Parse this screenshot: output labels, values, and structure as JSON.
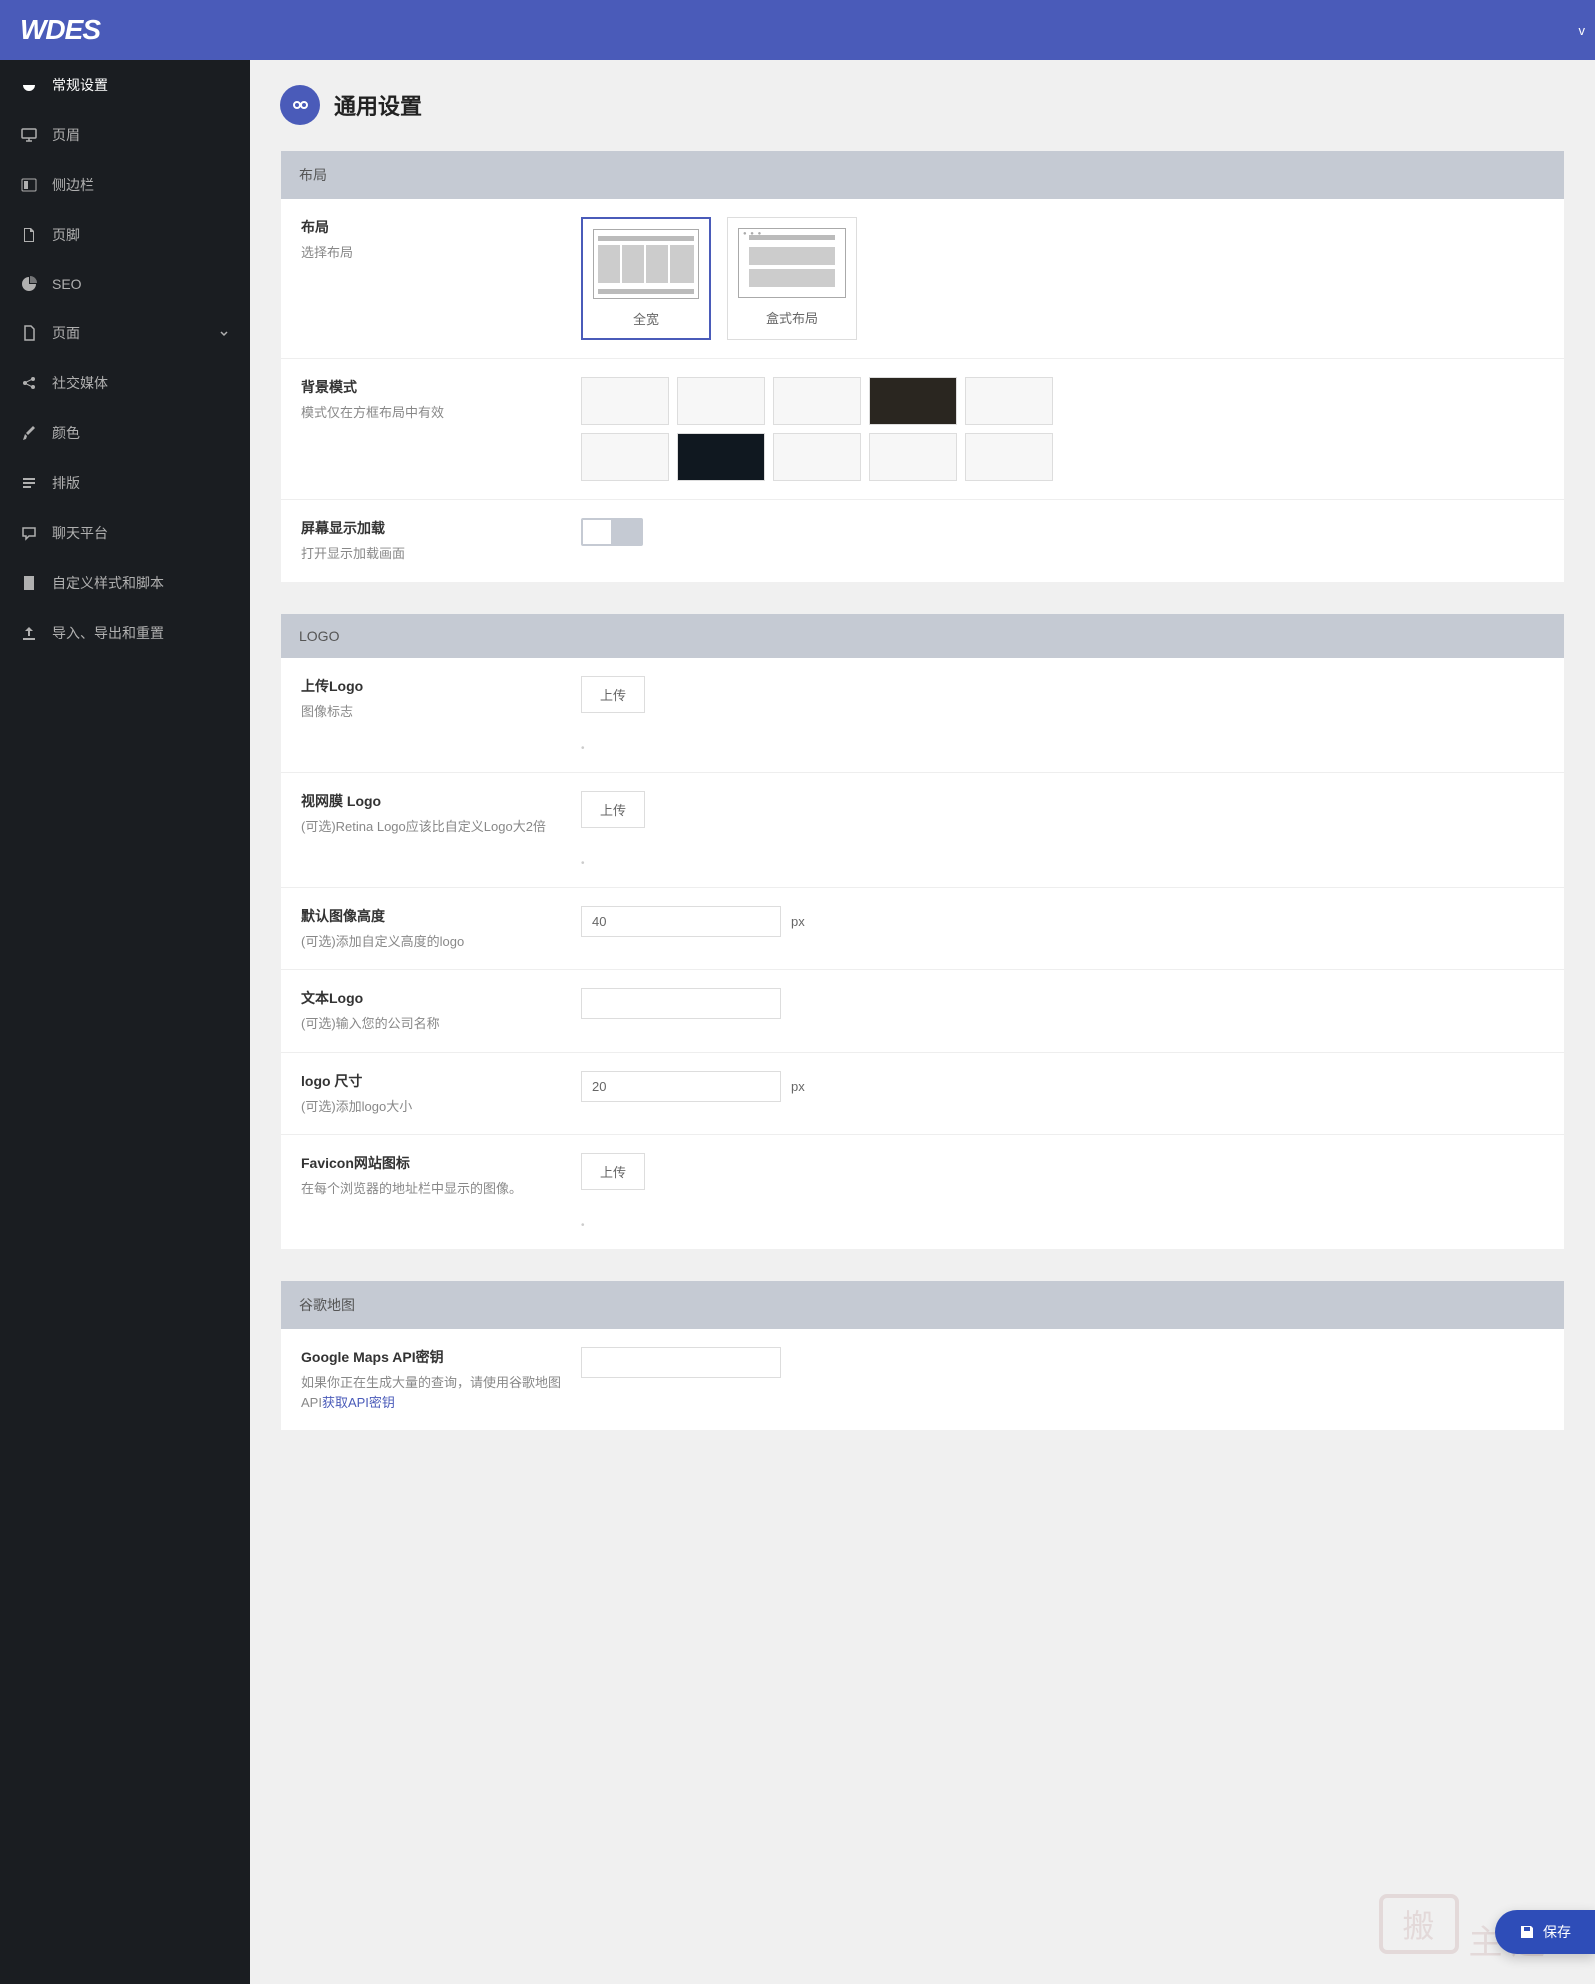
{
  "header": {
    "brand": "WDES",
    "right_char": "v"
  },
  "sidebar": {
    "items": [
      {
        "label": "常规设置",
        "icon": "dashboard-icon",
        "active": true
      },
      {
        "label": "页眉",
        "icon": "monitor-icon"
      },
      {
        "label": "侧边栏",
        "icon": "columns-icon"
      },
      {
        "label": "页脚",
        "icon": "file-icon"
      },
      {
        "label": "SEO",
        "icon": "chart-pie-icon"
      },
      {
        "label": "页面",
        "icon": "page-icon",
        "expandable": true
      },
      {
        "label": "社交媒体",
        "icon": "share-icon"
      },
      {
        "label": "颜色",
        "icon": "brush-icon"
      },
      {
        "label": "排版",
        "icon": "text-icon"
      },
      {
        "label": "聊天平台",
        "icon": "chat-icon"
      },
      {
        "label": "自定义样式和脚本",
        "icon": "file-alt-icon"
      },
      {
        "label": "导入、导出和重置",
        "icon": "upload-icon"
      }
    ]
  },
  "page": {
    "title": "通用设置"
  },
  "sections": {
    "layout": {
      "header": "布局",
      "layout_row": {
        "title": "布局",
        "desc": "选择布局",
        "options": [
          {
            "label": "全宽",
            "selected": true,
            "type": "full"
          },
          {
            "label": "盒式布局",
            "selected": false,
            "type": "boxed"
          }
        ]
      },
      "bg_row": {
        "title": "背景模式",
        "desc": "模式仅在方框布局中有效"
      },
      "loader_row": {
        "title": "屏幕显示加载",
        "desc": "打开显示加载画面"
      }
    },
    "logo": {
      "header": "LOGO",
      "upload_logo": {
        "title": "上传Logo",
        "desc": "图像标志",
        "btn": "上传"
      },
      "retina_logo": {
        "title": "视网膜 Logo",
        "desc": "(可选)Retina Logo应该比自定义Logo大2倍",
        "btn": "上传"
      },
      "default_height": {
        "title": "默认图像高度",
        "desc": "(可选)添加自定义高度的logo",
        "value": "40",
        "unit": "px"
      },
      "text_logo": {
        "title": "文本Logo",
        "desc": "(可选)输入您的公司名称",
        "value": ""
      },
      "logo_size": {
        "title": "logo 尺寸",
        "desc": "(可选)添加logo大小",
        "value": "20",
        "unit": "px"
      },
      "favicon": {
        "title": "Favicon网站图标",
        "desc": "在每个浏览器的地址栏中显示的图像。",
        "btn": "上传"
      }
    },
    "gmaps": {
      "header": "谷歌地图",
      "api_row": {
        "title": "Google Maps API密钥",
        "desc_pre": "如果你正在生成大量的查询，请使用谷歌地图API",
        "link": "获取API密钥",
        "value": ""
      }
    }
  },
  "save_btn": "保存"
}
